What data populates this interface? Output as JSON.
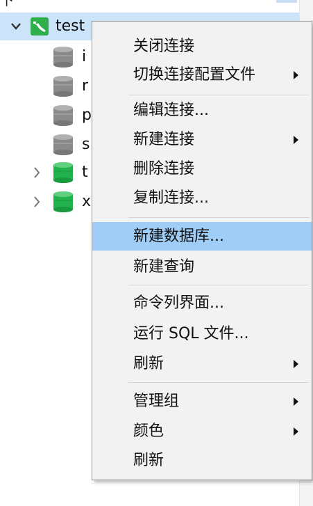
{
  "tree": {
    "top_glyph": "下",
    "connection": {
      "name": "test",
      "icon": "connection-icon"
    },
    "children": [
      {
        "label_fragment": "i",
        "type": "database-closed",
        "expandable": false
      },
      {
        "label_fragment": "r",
        "type": "database-closed",
        "expandable": false
      },
      {
        "label_fragment": "p",
        "type": "database-closed",
        "expandable": false
      },
      {
        "label_fragment": "s",
        "type": "database-closed",
        "expandable": false
      },
      {
        "label_fragment": "t",
        "type": "database-open",
        "expandable": true
      },
      {
        "label_fragment": "x",
        "type": "database-open",
        "expandable": true
      }
    ]
  },
  "context_menu": {
    "items": [
      {
        "label": "关闭连接",
        "submenu": false
      },
      {
        "label": "切换连接配置文件",
        "submenu": true
      },
      {
        "label": "编辑连接...",
        "submenu": false
      },
      {
        "label": "新建连接",
        "submenu": true
      },
      {
        "label": "删除连接",
        "submenu": false
      },
      {
        "label": "复制连接...",
        "submenu": false
      },
      {
        "label": "新建数据库...",
        "submenu": false,
        "highlighted": true
      },
      {
        "label": "新建查询",
        "submenu": false
      },
      {
        "label": "命令列界面...",
        "submenu": false
      },
      {
        "label": "运行 SQL 文件...",
        "submenu": false
      },
      {
        "label": "刷新",
        "submenu": true
      },
      {
        "label": "管理组",
        "submenu": true
      },
      {
        "label": "颜色",
        "submenu": true
      },
      {
        "label": "刷新",
        "submenu": false
      }
    ]
  },
  "colors": {
    "selection": "#cce4f9",
    "highlight": "#9fcdf5",
    "database_closed": "#8a8a8a",
    "database_open": "#22b24c",
    "connection_icon": "#2fae4b"
  }
}
